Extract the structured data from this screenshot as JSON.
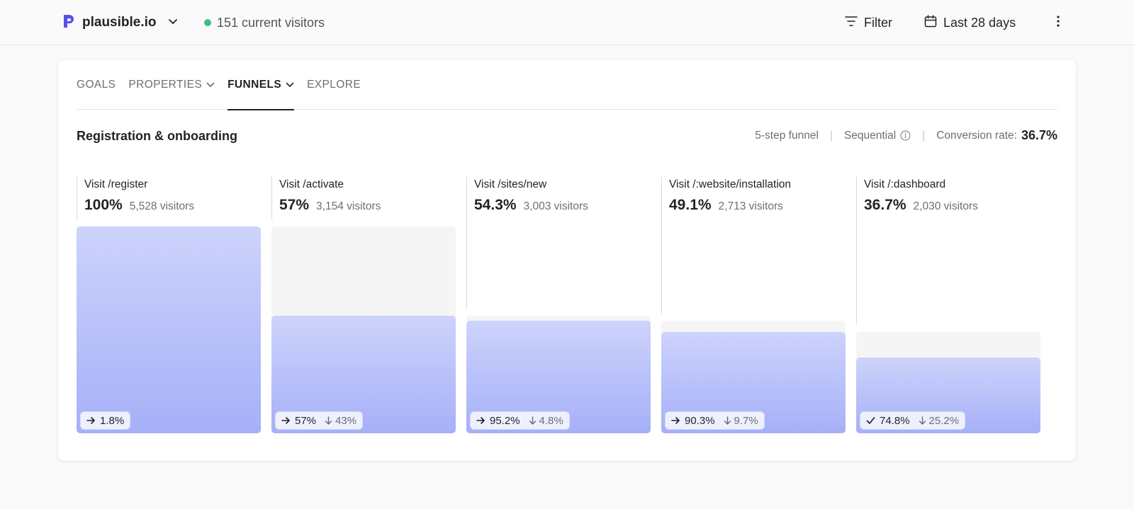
{
  "header": {
    "site_name": "plausible.io",
    "current_visitors": "151 current visitors",
    "filter_label": "Filter",
    "period_label": "Last 28 days",
    "colors": {
      "brand": "#5850ec",
      "live_dot": "#3fbf7f"
    }
  },
  "tabs": [
    {
      "label": "GOALS",
      "active": false,
      "dropdown": false
    },
    {
      "label": "PROPERTIES",
      "active": false,
      "dropdown": true
    },
    {
      "label": "FUNNELS",
      "active": true,
      "dropdown": true
    },
    {
      "label": "EXPLORE",
      "active": false,
      "dropdown": false
    }
  ],
  "funnel": {
    "name": "Registration & onboarding",
    "steps_label": "5-step funnel",
    "mode_label": "Sequential",
    "conversion_label": "Conversion rate:",
    "conversion_value": "36.7%",
    "colors": {
      "bar_top": "#cdd3fb",
      "bar_bottom": "#a6b0f8",
      "bar_bg": "#f5f5f5"
    },
    "steps": [
      {
        "name": "Visit /register",
        "percent": "100%",
        "visitors": "5,528 visitors",
        "fill_fraction": 1.0,
        "prev_fraction": 1.0,
        "badge_icon": "arrow-right-icon",
        "badge_primary": "1.8%",
        "badge_drop": ""
      },
      {
        "name": "Visit /activate",
        "percent": "57%",
        "visitors": "3,154 visitors",
        "fill_fraction": 0.57,
        "prev_fraction": 1.0,
        "badge_icon": "arrow-right-icon",
        "badge_primary": "57%",
        "badge_drop": "43%"
      },
      {
        "name": "Visit /sites/new",
        "percent": "54.3%",
        "visitors": "3,003 visitors",
        "fill_fraction": 0.543,
        "prev_fraction": 0.57,
        "badge_icon": "arrow-right-icon",
        "badge_primary": "95.2%",
        "badge_drop": "4.8%"
      },
      {
        "name": "Visit /:website/installation",
        "percent": "49.1%",
        "visitors": "2,713 visitors",
        "fill_fraction": 0.491,
        "prev_fraction": 0.543,
        "badge_icon": "arrow-right-icon",
        "badge_primary": "90.3%",
        "badge_drop": "9.7%"
      },
      {
        "name": "Visit /:dashboard",
        "percent": "36.7%",
        "visitors": "2,030 visitors",
        "fill_fraction": 0.367,
        "prev_fraction": 0.491,
        "badge_icon": "check-icon",
        "badge_primary": "74.8%",
        "badge_drop": "25.2%"
      }
    ]
  }
}
